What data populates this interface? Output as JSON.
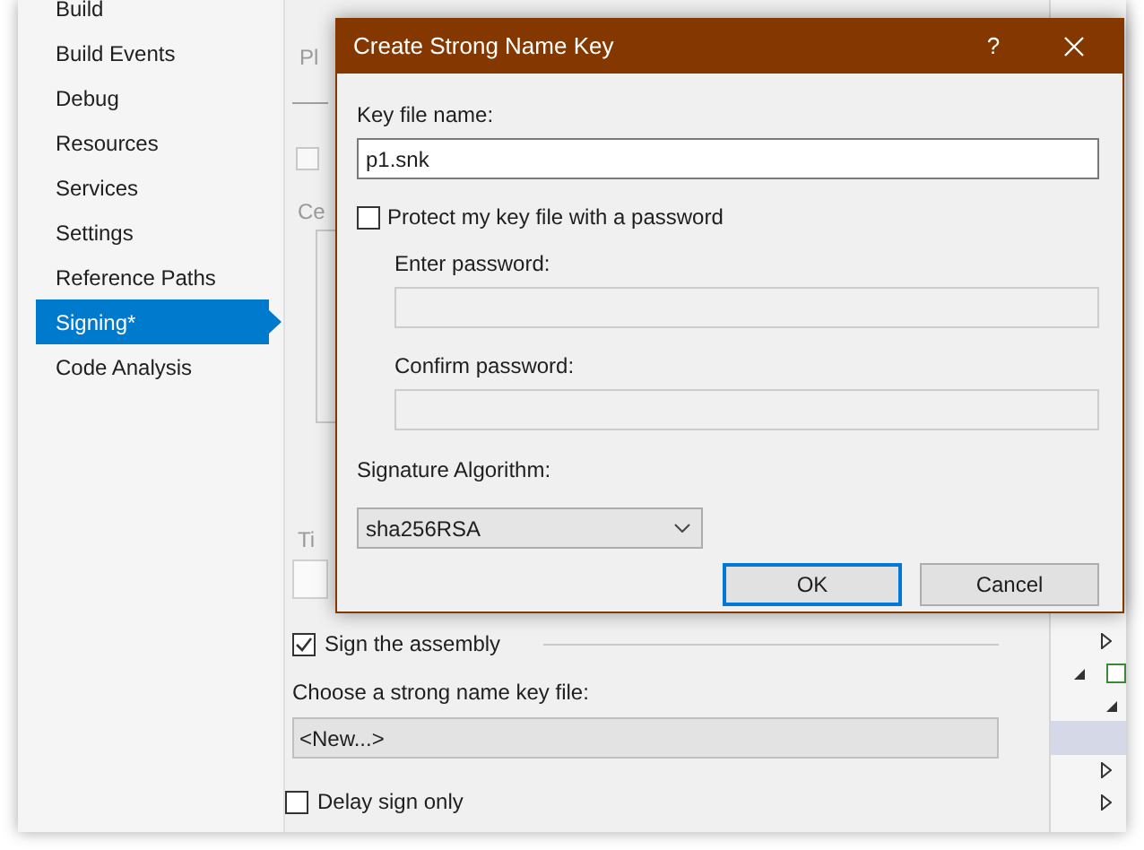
{
  "sidebar": {
    "items": [
      {
        "label": "Build",
        "selected": false
      },
      {
        "label": "Build Events",
        "selected": false
      },
      {
        "label": "Debug",
        "selected": false
      },
      {
        "label": "Resources",
        "selected": false
      },
      {
        "label": "Services",
        "selected": false
      },
      {
        "label": "Settings",
        "selected": false
      },
      {
        "label": "Reference Paths",
        "selected": false
      },
      {
        "label": "Signing*",
        "selected": true
      },
      {
        "label": "Code Analysis",
        "selected": false
      }
    ]
  },
  "page": {
    "heading_fragment": "Pl",
    "option_checkbox": {
      "checked": false
    },
    "section_fragment": "Ce",
    "timestamp_fragment": "Ti",
    "sign_assembly": {
      "label": "Sign the assembly",
      "checked": true
    },
    "key_file": {
      "label": "Choose a strong name key file:",
      "value": "<New...>"
    },
    "delay_sign": {
      "label": "Delay sign only",
      "checked": false
    }
  },
  "dialog": {
    "title": "Create Strong Name Key",
    "help": "?",
    "key_file_name": {
      "label": "Key file name:",
      "value": "p1.snk"
    },
    "protect": {
      "label": "Protect my key file with a password",
      "checked": false
    },
    "password_fields": [
      {
        "label": "Enter password:",
        "disabled": true
      },
      {
        "label": "Confirm password:",
        "disabled": true
      }
    ],
    "signature_algorithm": {
      "label": "Signature Algorithm:",
      "value": "sha256RSA"
    },
    "buttons": [
      {
        "label": "OK",
        "default": true
      },
      {
        "label": "Cancel",
        "default": false
      }
    ]
  }
}
